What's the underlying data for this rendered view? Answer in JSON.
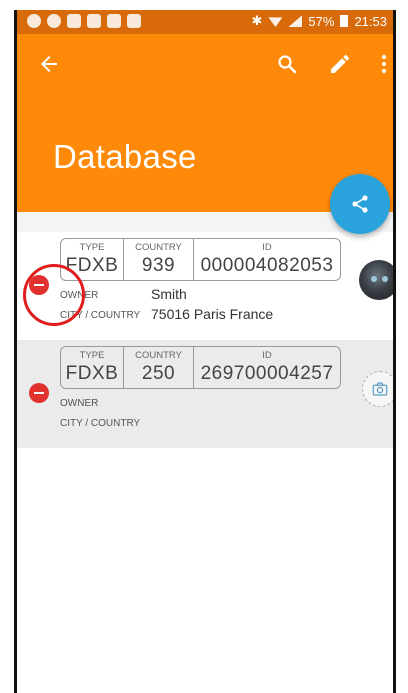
{
  "statusbar": {
    "battery": "57%",
    "time": "21:53"
  },
  "appbar": {
    "title": "Database",
    "icons": [
      "back-arrow-icon",
      "search-icon",
      "pencil-icon",
      "more-vert-icon"
    ]
  },
  "fab": {
    "icon": "share-icon",
    "color": "#2aa3dd"
  },
  "records": [
    {
      "type_label": "TYPE",
      "type": "FDXB",
      "country_label": "COUNTRY",
      "country": "939",
      "id_label": "ID",
      "id": "000004082053",
      "owner_label": "OWNER",
      "owner": "Smith",
      "city_label": "CITY / COUNTRY",
      "city": "75016 Paris France"
    },
    {
      "type_label": "TYPE",
      "type": "FDXB",
      "country_label": "COUNTRY",
      "country": "250",
      "id_label": "ID",
      "id": "269700004257",
      "owner_label": "OWNER",
      "owner": "",
      "city_label": "CITY / COUNTRY",
      "city": ""
    }
  ],
  "colors": {
    "accent": "#ff8a0a",
    "statusbar": "#d86a09",
    "remove": "#e0312e",
    "annotation": "#e01c1c"
  }
}
